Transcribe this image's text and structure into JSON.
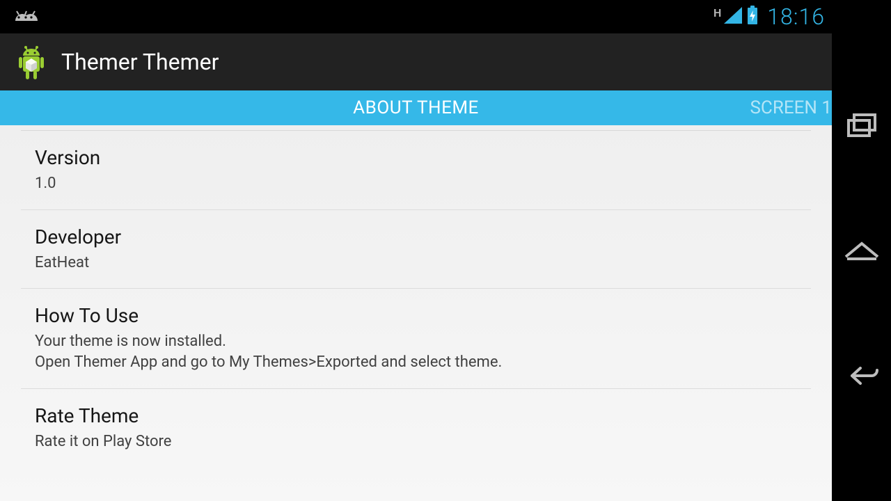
{
  "status": {
    "network_type": "H",
    "time": "18:16"
  },
  "action_bar": {
    "title": "Themer Themer"
  },
  "tabs": {
    "active": "ABOUT THEME",
    "next": "SCREEN 1"
  },
  "list": [
    {
      "title": "Version",
      "subtitle": "1.0"
    },
    {
      "title": "Developer",
      "subtitle": "EatHeat"
    },
    {
      "title": "How To Use",
      "subtitle": "Your theme is now installed.\nOpen Themer App and go to My Themes>Exported and select theme."
    },
    {
      "title": "Rate Theme",
      "subtitle": "Rate it on Play Store"
    }
  ],
  "icons": {
    "debug": "android-debug-icon",
    "signal": "signal-icon",
    "battery": "battery-charging-icon",
    "app": "android-cube-icon",
    "recent": "recent-apps-icon",
    "home": "home-icon",
    "back": "back-icon"
  }
}
